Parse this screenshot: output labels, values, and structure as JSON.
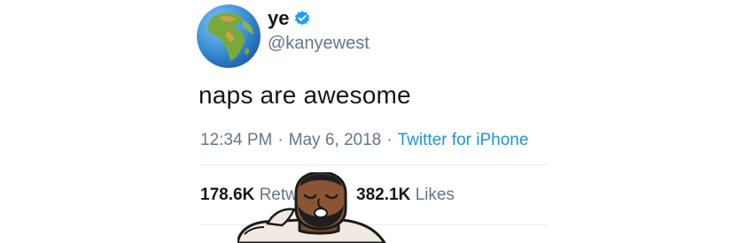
{
  "tweet": {
    "display_name": "ye",
    "handle": "@kanyewest",
    "text": "naps are awesome",
    "time": "12:34 PM",
    "date": "May 6, 2018",
    "separator": "·",
    "source": "Twitter for iPhone",
    "retweets_count": "178.6K",
    "retweets_label_visible": "Retw",
    "likes_count": "382.1K",
    "likes_label": "Likes"
  },
  "icons": {
    "avatar": "earth-globe-icon",
    "verified": "verified-badge-icon",
    "overlay": "cartoon-sleeping-face"
  },
  "colors": {
    "text": "#14171a",
    "muted": "#657786",
    "link": "#1b95e0",
    "verified": "#1da1f2"
  }
}
